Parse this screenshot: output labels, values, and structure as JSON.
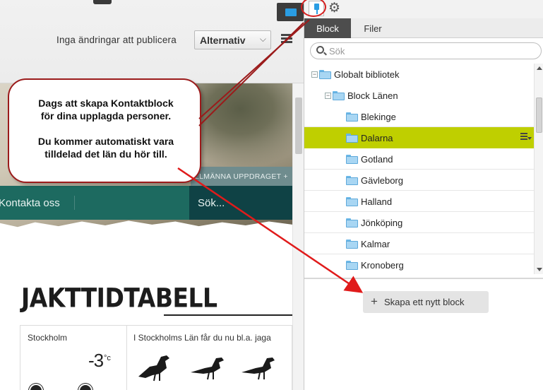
{
  "toolbar": {
    "publish_status": "Inga ändringar att publicera",
    "options_button": "Alternativ",
    "options_chevron": "⌵"
  },
  "preview": {
    "strip_text": "LLMÄNNA UPPDRAGET +",
    "nav_item": "Kontakta oss",
    "nav_search": "Sök...",
    "title": "JAKTTIDTABELL",
    "weather_city": "Stockholm",
    "weather_temp": "-3",
    "weather_unit": "°c",
    "info_text": "I Stockholms Län får du nu bl.a. jaga"
  },
  "callout": {
    "line1": "Dags att skapa Kontaktblock",
    "line2": "för dina upplagda personer.",
    "line3": "Du kommer automatiskt vara",
    "line4": "tilldelad det län du hör till."
  },
  "panel": {
    "tabs": [
      "Block",
      "Filer"
    ],
    "search_placeholder": "Sök",
    "gear_icon": "⚙",
    "tree": [
      {
        "label": "Globalt bibliotek",
        "toggle": "−"
      },
      {
        "label": "Block Länen",
        "toggle": "−"
      },
      {
        "label": "Blekinge"
      },
      {
        "label": "Dalarna",
        "selected": true
      },
      {
        "label": "Gotland"
      },
      {
        "label": "Gävleborg"
      },
      {
        "label": "Halland"
      },
      {
        "label": "Jönköping"
      },
      {
        "label": "Kalmar"
      },
      {
        "label": "Kronoberg"
      }
    ],
    "create_plus": "+",
    "create_button": "Skapa ett nytt block"
  },
  "colors": {
    "selected_row": "#bfcf00",
    "callout_border": "#9b1b1b",
    "arrow": "#e01b1b",
    "nav": "#1d6a60"
  }
}
